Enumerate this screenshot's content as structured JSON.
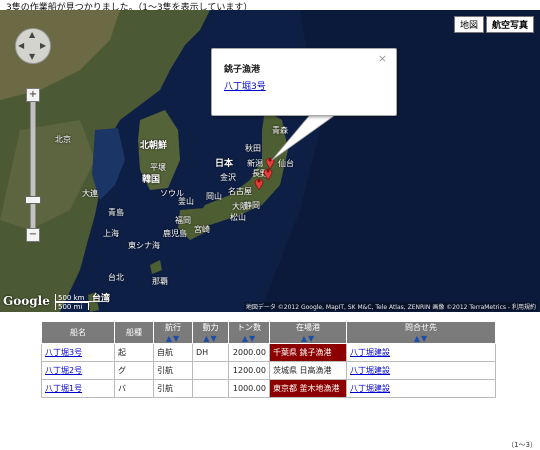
{
  "status_text": "3隻の作業船が見つかりました。（1～3隻を表示しています）",
  "map": {
    "btn_map": "地図",
    "btn_satellite": "航空写真",
    "labels": [
      {
        "text": "北京",
        "big": false
      },
      {
        "text": "北朝鮮",
        "big": true
      },
      {
        "text": "韓国",
        "big": true
      },
      {
        "text": "日本",
        "big": true
      },
      {
        "text": "東シナ海",
        "big": false
      },
      {
        "text": "上海",
        "big": false
      },
      {
        "text": "台北",
        "big": false
      },
      {
        "text": "青森",
        "big": false
      },
      {
        "text": "秋田",
        "big": false
      },
      {
        "text": "仙台",
        "big": false
      },
      {
        "text": "新潟",
        "big": false
      },
      {
        "text": "金沢",
        "big": false
      },
      {
        "text": "長野",
        "big": false
      },
      {
        "text": "名古屋",
        "big": false
      },
      {
        "text": "大阪",
        "big": false
      },
      {
        "text": "静岡",
        "big": false
      },
      {
        "text": "岡山",
        "big": false
      },
      {
        "text": "松山",
        "big": false
      },
      {
        "text": "福岡",
        "big": false
      },
      {
        "text": "宮崎",
        "big": false
      },
      {
        "text": "鹿児島",
        "big": false
      },
      {
        "text": "那覇",
        "big": false
      },
      {
        "text": "大連",
        "big": false
      },
      {
        "text": "平壌",
        "big": false
      },
      {
        "text": "ソウル",
        "big": false
      },
      {
        "text": "釜山",
        "big": false
      },
      {
        "text": "青島",
        "big": false
      }
    ],
    "popup_title": "銚子漁港",
    "popup_link": "八丁堀3号",
    "popup_close": "×",
    "google_logo": "Google",
    "scale_km": "500 km",
    "scale_mi": "500 mi",
    "scale_place": "台湾",
    "attribution": "地図データ ©2012 Google, MapIT, SK M&C, Tele Atlas, ZENRIN 画像 ©2012 TerraMetrics - 利用規約"
  },
  "table": {
    "headers": [
      "船名",
      "船種",
      "航行",
      "動力",
      "トン数",
      "在場港",
      "問合せ先"
    ],
    "sort_arrows": "▲▼",
    "rows": [
      {
        "name": "八丁堀3号",
        "type": "起",
        "nav": "自航",
        "power": "DH",
        "tons": "2000.00",
        "port": "千葉県 銚子漁港",
        "contact": "八丁堀建設",
        "highlight": true
      },
      {
        "name": "八丁堀2号",
        "type": "グ",
        "nav": "引航",
        "power": "",
        "tons": "1200.00",
        "port": "茨城県 日高漁港",
        "contact": "八丁堀建設",
        "highlight": false
      },
      {
        "name": "八丁堀1号",
        "type": "バ",
        "nav": "引航",
        "power": "",
        "tons": "1000.00",
        "port": "東京都 釜木地漁港",
        "contact": "八丁堀建設",
        "highlight": true
      }
    ]
  },
  "footer_count": "（1～3）",
  "colors": {
    "header_bg": "#7b7b7b",
    "port_highlight": "#8c0000",
    "link": "#0000cc"
  }
}
